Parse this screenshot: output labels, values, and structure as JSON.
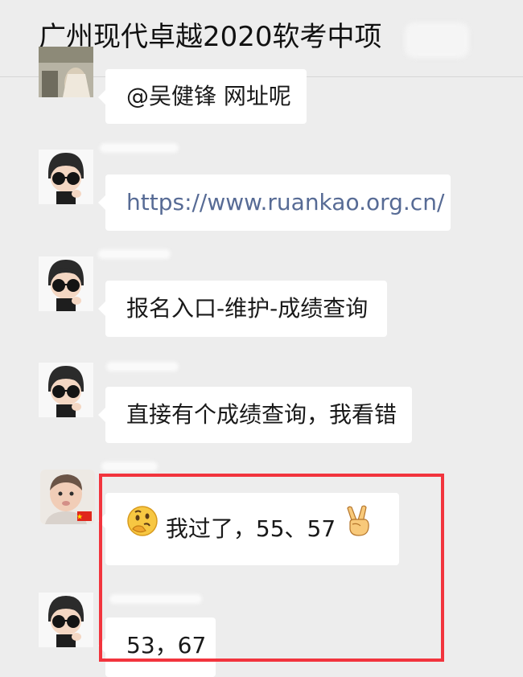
{
  "header": {
    "title": "广州现代卓越2020软考中项"
  },
  "messages": [
    {
      "text": "@吴健锋 网址呢",
      "avatar": "photo-avatar"
    },
    {
      "text": "https://www.ruankao.org.cn/",
      "avatar": "cartoon-avatar"
    },
    {
      "text": "报名入口-维护-成绩查询",
      "avatar": "cartoon-avatar"
    },
    {
      "text": "直接有个成绩查询，我看错",
      "avatar": "cartoon-avatar"
    },
    {
      "text": "我过了，55、57",
      "avatar": "baby-avatar",
      "prefix_icon": "thinking-face-emoji-icon",
      "suffix_icon": "victory-hand-emoji-icon"
    },
    {
      "text": "53，67",
      "avatar": "cartoon-avatar"
    }
  ],
  "colors": {
    "highlight": "#f2343d",
    "link": "#576b95",
    "background": "#ededed"
  }
}
